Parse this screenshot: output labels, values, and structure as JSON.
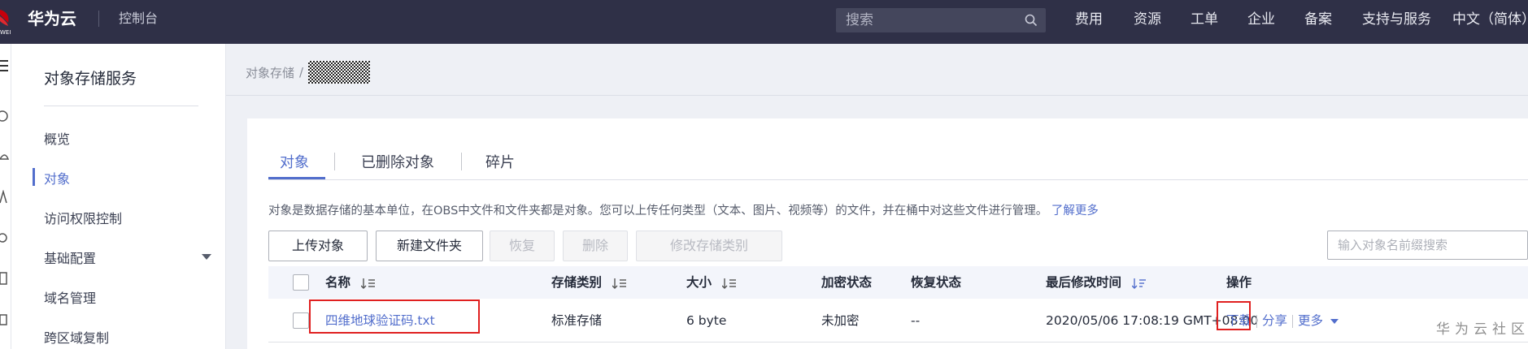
{
  "topbar": {
    "brand": "华为云",
    "console": "控制台",
    "search_placeholder": "搜索",
    "nav": [
      "费用",
      "资源",
      "工单",
      "企业",
      "备案",
      "支持与服务",
      "中文（简体）"
    ]
  },
  "sidebar": {
    "title": "对象存储服务",
    "items": [
      {
        "label": "概览"
      },
      {
        "label": "对象"
      },
      {
        "label": "访问权限控制"
      },
      {
        "label": "基础配置"
      },
      {
        "label": "域名管理"
      },
      {
        "label": "跨区域复制"
      }
    ]
  },
  "breadcrumb": {
    "root": "对象存储",
    "sep": "/"
  },
  "tabs": [
    "对象",
    "已删除对象",
    "碎片"
  ],
  "description": {
    "text": "对象是数据存储的基本单位，在OBS中文件和文件夹都是对象。您可以上传任何类型（文本、图片、视频等）的文件，并在桶中对这些文件进行管理。",
    "learn_more": "了解更多"
  },
  "toolbar": {
    "upload": "上传对象",
    "new_folder": "新建文件夹",
    "restore": "恢复",
    "delete": "删除",
    "change_class": "修改存储类别",
    "prefix_placeholder": "输入对象名前缀搜索"
  },
  "table": {
    "columns": [
      "名称",
      "存储类别",
      "大小",
      "加密状态",
      "恢复状态",
      "最后修改时间",
      "操作"
    ],
    "rows": [
      {
        "name": "四维地球验证码.txt",
        "storage_class": "标准存储",
        "size": "6 byte",
        "encryption": "未加密",
        "restore": "--",
        "modified": "2020/05/06 17:08:19 GMT+08:00",
        "ops": {
          "download": "下载",
          "share": "分享",
          "more": "更多"
        }
      }
    ]
  },
  "watermark": "华为云社区",
  "colors": {
    "topbar": "#2f3047",
    "accent": "#526ecc",
    "highlight": "#e02020",
    "brand_red": "#c7000b"
  }
}
